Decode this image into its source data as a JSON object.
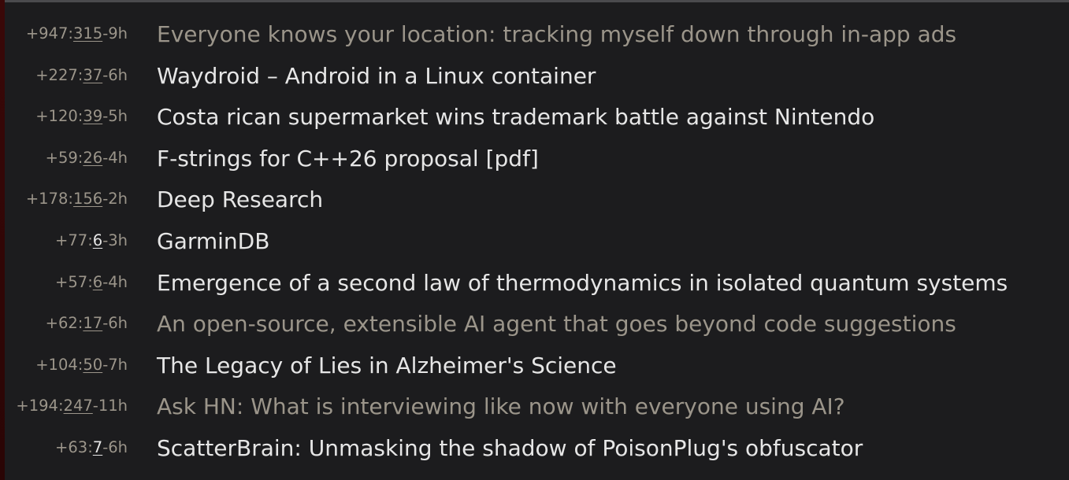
{
  "stories": [
    {
      "points": "+947",
      "comments": "315",
      "age": "-9h",
      "title": "Everyone knows your location: tracking myself down through in-app ads",
      "visited": true,
      "new_comments": false
    },
    {
      "points": "+227",
      "comments": "37",
      "age": "-6h",
      "title": "Waydroid – Android in a Linux container",
      "visited": false,
      "new_comments": false
    },
    {
      "points": "+120",
      "comments": "39",
      "age": "-5h",
      "title": "Costa rican supermarket wins trademark battle against Nintendo",
      "visited": false,
      "new_comments": false
    },
    {
      "points": "+59",
      "comments": "26",
      "age": "-4h",
      "title": "F-strings for C++26 proposal [pdf]",
      "visited": false,
      "new_comments": false
    },
    {
      "points": "+178",
      "comments": "156",
      "age": "-2h",
      "title": "Deep Research",
      "visited": false,
      "new_comments": false
    },
    {
      "points": "+77",
      "comments": "6",
      "age": "-3h",
      "title": "GarminDB",
      "visited": false,
      "new_comments": true
    },
    {
      "points": "+57",
      "comments": "6",
      "age": "-4h",
      "title": "Emergence of a second law of thermodynamics in isolated quantum systems",
      "visited": false,
      "new_comments": false
    },
    {
      "points": "+62",
      "comments": "17",
      "age": "-6h",
      "title": "An open-source, extensible AI agent that goes beyond code suggestions",
      "visited": true,
      "new_comments": false
    },
    {
      "points": "+104",
      "comments": "50",
      "age": "-7h",
      "title": "The Legacy of Lies in Alzheimer's Science",
      "visited": false,
      "new_comments": false
    },
    {
      "points": "+194",
      "comments": "247",
      "age": "-11h",
      "title": "Ask HN: What is interviewing like now with everyone using AI?",
      "visited": true,
      "new_comments": false
    },
    {
      "points": "+63",
      "comments": "7",
      "age": "-6h",
      "title": "ScatterBrain: Unmasking the shadow of PoisonPlug's obfuscator",
      "visited": false,
      "new_comments": true
    }
  ],
  "colors": {
    "background": "#1c1c1e",
    "title": "#e6e6e6",
    "visited_title": "#9b958a",
    "meta": "#9b958a"
  }
}
